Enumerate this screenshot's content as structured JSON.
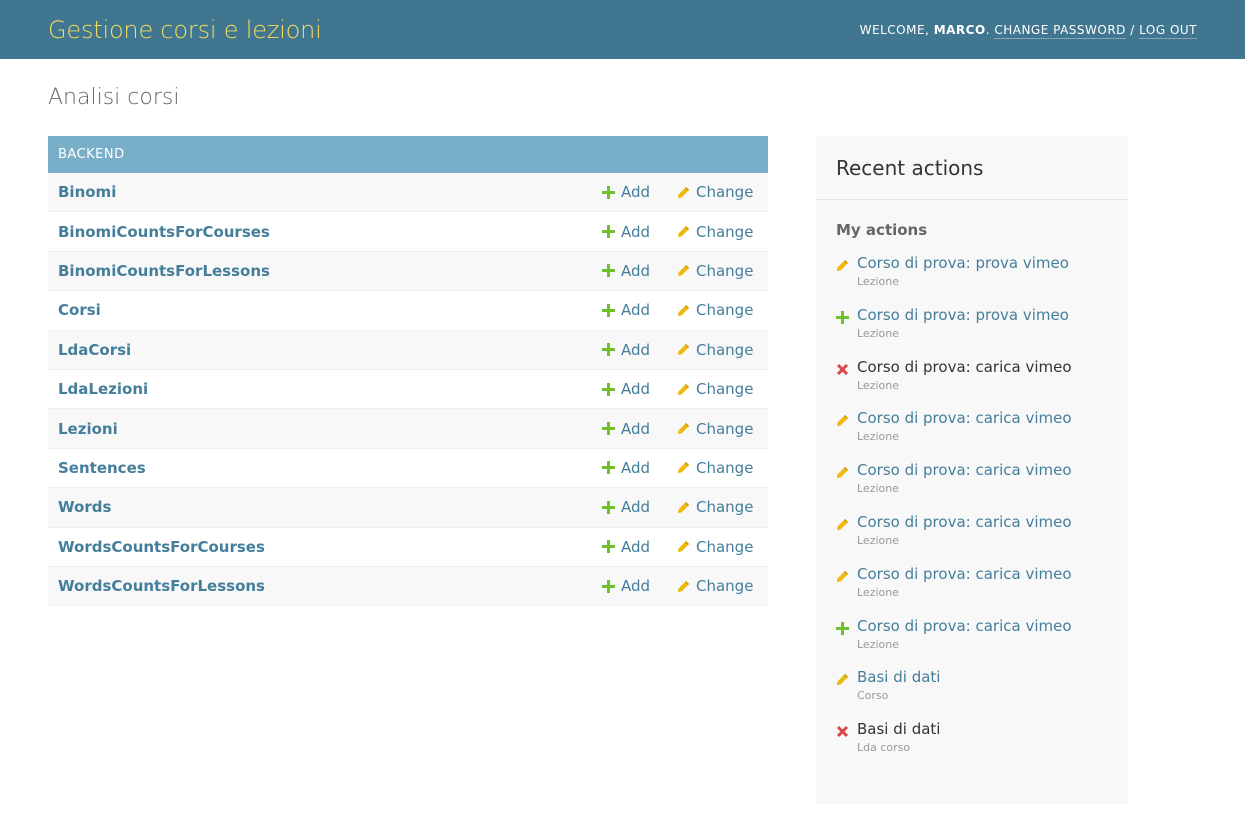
{
  "header": {
    "site_name": "Gestione corsi e lezioni",
    "welcome": "Welcome,",
    "user": "Marco",
    "change_password": "Change password",
    "separator": "/",
    "logout": "Log out"
  },
  "page_title": "Analisi corsi",
  "module": {
    "caption": "BACKEND",
    "add_label": "Add",
    "change_label": "Change",
    "models": [
      "Binomi",
      "BinomiCountsForCourses",
      "BinomiCountsForLessons",
      "Corsi",
      "LdaCorsi",
      "LdaLezioni",
      "Lezioni",
      "Sentences",
      "Words",
      "WordsCountsForCourses",
      "WordsCountsForLessons"
    ]
  },
  "recent_actions": {
    "title": "Recent actions",
    "subtitle": "My actions",
    "items": [
      {
        "kind": "change",
        "title": "Corso di prova: prova vimeo",
        "type": "Lezione"
      },
      {
        "kind": "add",
        "title": "Corso di prova: prova vimeo",
        "type": "Lezione"
      },
      {
        "kind": "delete",
        "title": "Corso di prova: carica vimeo",
        "type": "Lezione"
      },
      {
        "kind": "change",
        "title": "Corso di prova: carica vimeo",
        "type": "Lezione"
      },
      {
        "kind": "change",
        "title": "Corso di prova: carica vimeo",
        "type": "Lezione"
      },
      {
        "kind": "change",
        "title": "Corso di prova: carica vimeo",
        "type": "Lezione"
      },
      {
        "kind": "change",
        "title": "Corso di prova: carica vimeo",
        "type": "Lezione"
      },
      {
        "kind": "add",
        "title": "Corso di prova: carica vimeo",
        "type": "Lezione"
      },
      {
        "kind": "change",
        "title": "Basi di dati",
        "type": "Corso"
      },
      {
        "kind": "delete",
        "title": "Basi di dati",
        "type": "Lda corso"
      }
    ]
  },
  "colors": {
    "header_bg": "#417690",
    "site_name": "#f5dd5d",
    "caption_bg": "#79aec8",
    "link": "#447e9b",
    "add_icon": "#70bf2b",
    "change_icon": "#efb80b",
    "delete_icon": "#dd4646"
  },
  "icons": {
    "add": "plus-icon",
    "change": "pencil-icon",
    "delete": "x-icon"
  }
}
